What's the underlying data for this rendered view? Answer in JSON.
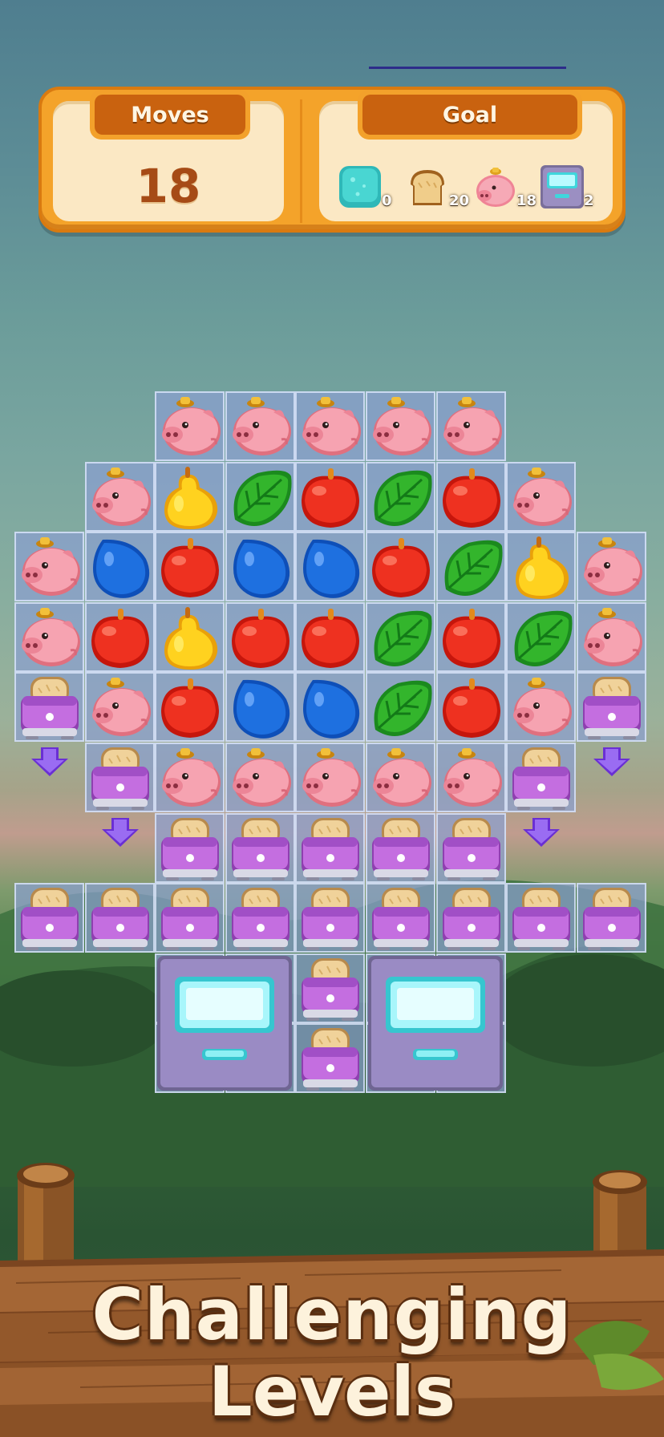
{
  "hud": {
    "moves_label": "Moves",
    "moves_value": "18",
    "goal_label": "Goal",
    "goals": [
      {
        "icon": "ice-block-icon",
        "count": "0"
      },
      {
        "icon": "bread-icon",
        "count": "20"
      },
      {
        "icon": "pig-icon",
        "count": "18"
      },
      {
        "icon": "drawer-icon",
        "count": "2"
      }
    ]
  },
  "board": {
    "rows": [
      [
        "",
        "",
        "pig",
        "pig",
        "pig",
        "pig",
        "pig",
        "",
        ""
      ],
      [
        "",
        "pig",
        "pear",
        "leaf",
        "apple",
        "leaf",
        "apple",
        "pig",
        ""
      ],
      [
        "pig",
        "drop",
        "apple",
        "drop",
        "drop",
        "apple",
        "leaf",
        "pear",
        "pig"
      ],
      [
        "pig",
        "apple",
        "pear",
        "apple",
        "apple",
        "leaf",
        "apple",
        "leaf",
        "pig"
      ],
      [
        "toaster",
        "pig",
        "apple",
        "drop",
        "drop",
        "leaf",
        "apple",
        "pig",
        "toaster"
      ],
      [
        "",
        "toaster",
        "pig",
        "pig",
        "pig",
        "pig",
        "pig",
        "toaster",
        ""
      ],
      [
        "",
        "",
        "toaster",
        "toaster",
        "toaster",
        "toaster",
        "toaster",
        "",
        ""
      ],
      [
        "toaster",
        "toaster",
        "toaster",
        "toaster",
        "toaster",
        "toaster",
        "toaster",
        "toaster",
        "toaster"
      ],
      [
        "",
        "",
        "drawer",
        "drawer",
        "toaster",
        "drawer",
        "drawer",
        "",
        ""
      ],
      [
        "",
        "",
        "drawer",
        "drawer",
        "toaster",
        "drawer",
        "drawer",
        "",
        ""
      ]
    ]
  },
  "colors": {
    "hud_orange": "#f4a32a",
    "hud_tab_brown": "#c9620f",
    "moves_text": "#a64b16",
    "cell_blue": "#8aa0d0",
    "arrow_purple": "#8a55e6"
  },
  "banner": {
    "line1": "Challenging",
    "line2": "Levels"
  }
}
